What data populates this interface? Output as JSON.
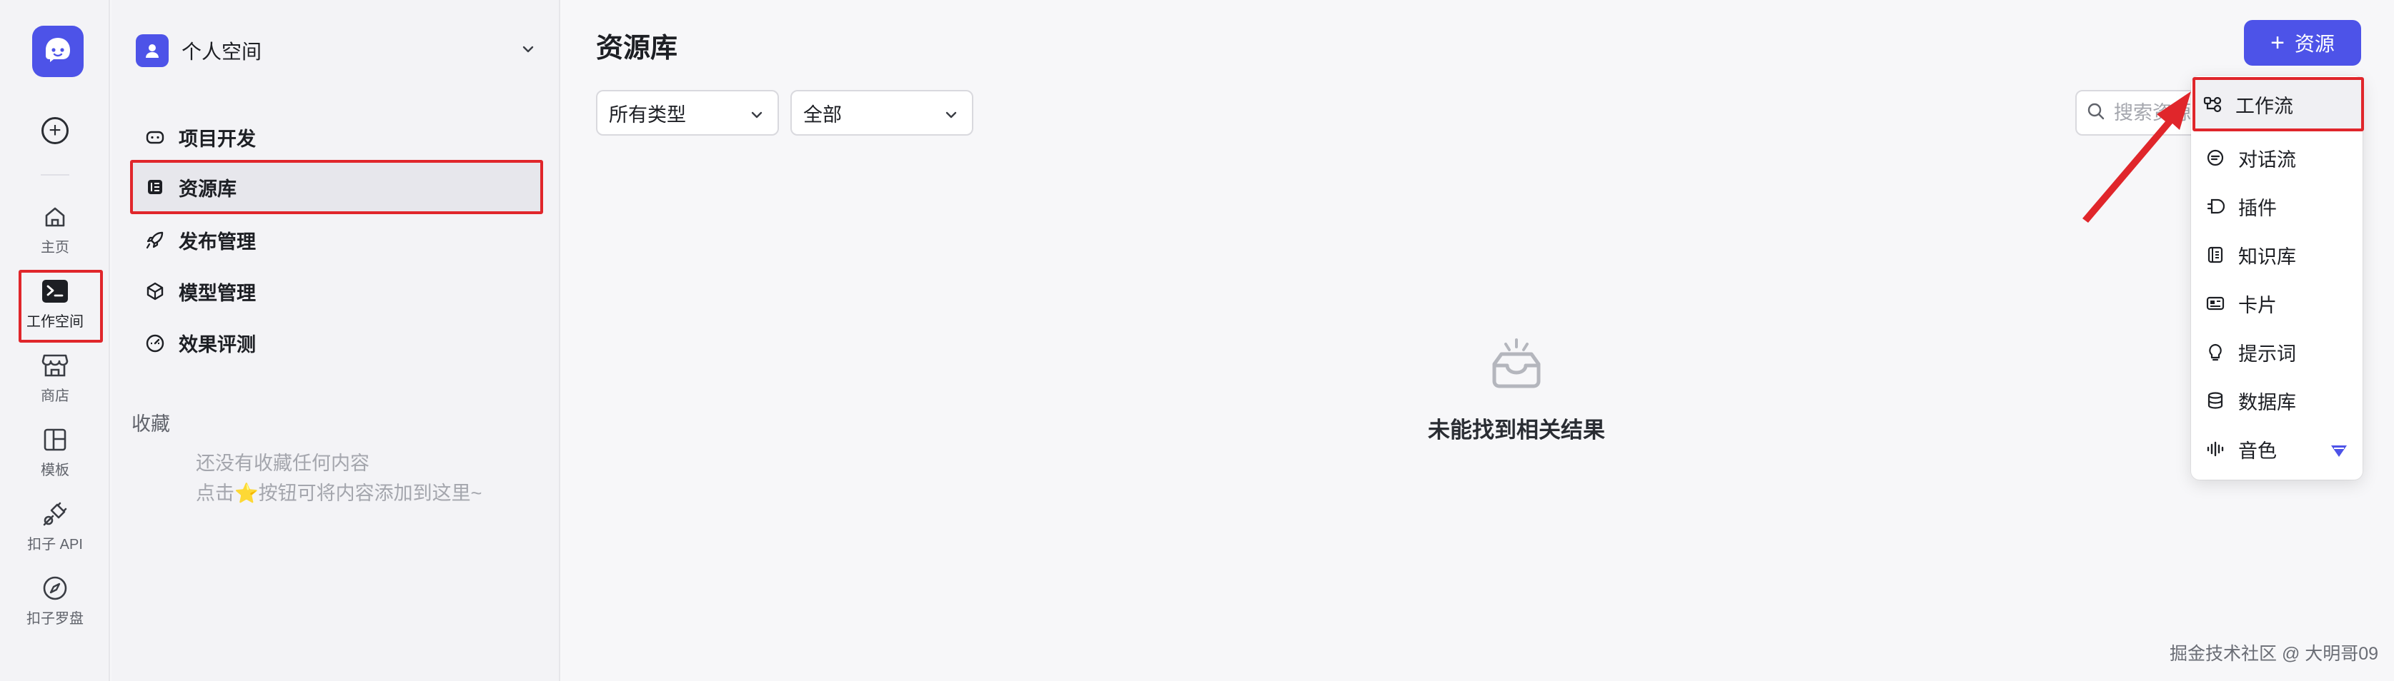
{
  "rail": {
    "items": [
      {
        "label": "主页",
        "icon": "home-icon"
      },
      {
        "label": "工作空间",
        "icon": "workspace-terminal-icon"
      },
      {
        "label": "商店",
        "icon": "store-icon"
      },
      {
        "label": "模板",
        "icon": "template-icon"
      },
      {
        "label": "扣子 API",
        "icon": "api-plug-icon"
      },
      {
        "label": "扣子罗盘",
        "icon": "compass-icon"
      }
    ],
    "active": "工作空间"
  },
  "sidebar": {
    "space_name": "个人空间",
    "items": [
      {
        "label": "项目开发",
        "icon": "gamepad-icon"
      },
      {
        "label": "资源库",
        "icon": "library-icon"
      },
      {
        "label": "发布管理",
        "icon": "rocket-icon"
      },
      {
        "label": "模型管理",
        "icon": "cube-icon"
      },
      {
        "label": "效果评测",
        "icon": "gauge-icon"
      }
    ],
    "active": "资源库",
    "favorites_title": "收藏",
    "favorites_empty_line1": "还没有收藏任何内容",
    "favorites_empty_line2": "点击⭐按钮可将内容添加到这里~"
  },
  "main": {
    "title": "资源库",
    "add_button": "资源",
    "filter_type": "所有类型",
    "filter_scope": "全部",
    "search_placeholder": "搜索资源",
    "empty_text": "未能找到相关结果"
  },
  "dropdown": {
    "items": [
      {
        "label": "工作流",
        "icon": "workflow-icon"
      },
      {
        "label": "对话流",
        "icon": "chatflow-icon"
      },
      {
        "label": "插件",
        "icon": "plugin-icon"
      },
      {
        "label": "知识库",
        "icon": "knowledge-icon"
      },
      {
        "label": "卡片",
        "icon": "card-icon"
      },
      {
        "label": "提示词",
        "icon": "prompt-icon"
      },
      {
        "label": "数据库",
        "icon": "database-icon"
      },
      {
        "label": "音色",
        "icon": "voice-icon"
      }
    ],
    "highlighted": "工作流"
  },
  "watermark": "掘金技术社区 @ 大明哥09",
  "colors": {
    "accent": "#4d53e8",
    "annotation_red": "#e0262b",
    "background": "#f7f7f9"
  }
}
